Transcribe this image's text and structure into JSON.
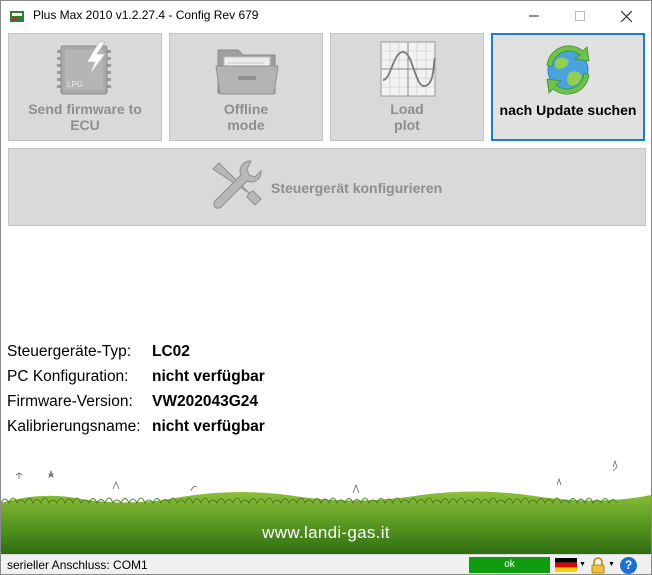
{
  "window": {
    "title": "Plus Max 2010 v1.2.27.4 - Config Rev 679"
  },
  "buttons": {
    "send_firmware": {
      "line1": "Send firmware to",
      "line2": "ECU",
      "icon": "ecu-chip-icon",
      "chip_text": "LPG"
    },
    "offline": {
      "line1": "Offline",
      "line2": "mode",
      "icon": "folder-icon"
    },
    "load_plot": {
      "line1": "Load",
      "line2": "plot",
      "icon": "plot-icon"
    },
    "update": {
      "label": "nach Update suchen",
      "icon": "refresh-globe-icon"
    },
    "configure": {
      "label": "Steuergerät konfigurieren",
      "icon": "tools-icon"
    }
  },
  "info": {
    "rows": [
      {
        "key": "Steuergeräte-Typ:",
        "value": "LC02"
      },
      {
        "key": "PC Konfiguration:",
        "value": "nicht verfügbar"
      },
      {
        "key": "Firmware-Version:",
        "value": "VW202043G24"
      },
      {
        "key": "Kalibrierungsname:",
        "value": "nicht verfügbar"
      }
    ]
  },
  "footer": {
    "website": "www.landi-gas.it"
  },
  "statusbar": {
    "connection": "serieller Anschluss: COM1",
    "status": "ok",
    "status_color": "#0f9d0f",
    "language_icon": "german-flag-icon",
    "lock_icon": "lock-icon",
    "help_icon": "help-icon"
  },
  "colors": {
    "accent": "#1c7cd6",
    "button_bg": "#d9d9d9",
    "disabled_text": "#8e8e8e"
  }
}
